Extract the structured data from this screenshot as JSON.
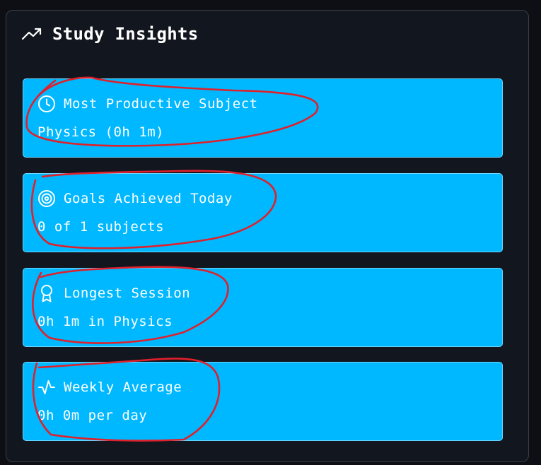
{
  "panel": {
    "title": "Study Insights",
    "title_icon": "trending-up-icon"
  },
  "insights": [
    {
      "icon": "clock-icon",
      "label": "Most Productive Subject",
      "value": "Physics (0h 1m)"
    },
    {
      "icon": "target-icon",
      "label": "Goals Achieved Today",
      "value": "0 of 1 subjects"
    },
    {
      "icon": "award-icon",
      "label": "Longest Session",
      "value": "0h 1m in Physics"
    },
    {
      "icon": "activity-icon",
      "label": "Weekly Average",
      "value": "0h 0m per day"
    }
  ],
  "colors": {
    "background": "#0d0f14",
    "panel": "#12161e",
    "card": "#00b8ff",
    "text": "#ffffff",
    "annotation": "#e0202a"
  }
}
